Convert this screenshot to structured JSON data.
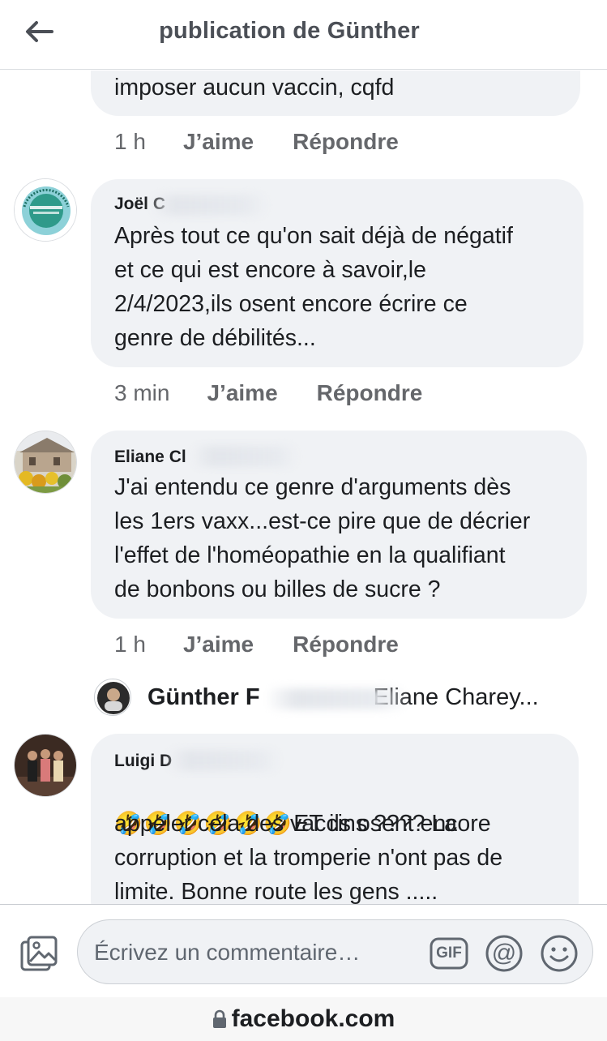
{
  "header": {
    "title": "publication de Günther"
  },
  "comments": [
    {
      "text": "imposer aucun vaccin, cqfd",
      "time": "1 h",
      "like": "J’aime",
      "reply": "Répondre"
    },
    {
      "author": "Joël C",
      "text": "Après tout ce qu'on sait déjà de négatif\net ce qui est encore à savoir,le\n2/4/2023,ils osent encore écrire ce\ngenre de débilités...",
      "time": "3 min",
      "like": "J’aime",
      "reply": "Répondre",
      "avatar_badge": "JE NE SUIS PAS VACCINÉ"
    },
    {
      "author": "Eliane Cl",
      "text": "J'ai entendu ce genre d'arguments dès\nles 1ers vaxx...est-ce pire que de décrier\nl'effet de l'homéopathie en la qualifiant\nde bonbons ou billes de sucre ?",
      "time": "1 h",
      "like": "J’aime",
      "reply": "Répondre"
    },
    {
      "author": "Luigi D",
      "emoji": "🤣🤣🤣🤣🤣🤣",
      "text_first": "ET ils osent encore",
      "text": "appeler cela des vaccins ???? La\ncorruption et la  tromperie n'ont pas de\nlimite. Bonne route les gens ....."
    }
  ],
  "reply_preview": {
    "author": "Günther F",
    "target": "Eliane Charey..."
  },
  "composer": {
    "placeholder": "Écrivez un commentaire…",
    "gif_label": "GIF",
    "mention_label": "@"
  },
  "browser": {
    "url": "facebook.com"
  },
  "colors": {
    "bubble": "#f0f2f5",
    "secondary_text": "#65676b",
    "title_text": "#4b4f56"
  }
}
